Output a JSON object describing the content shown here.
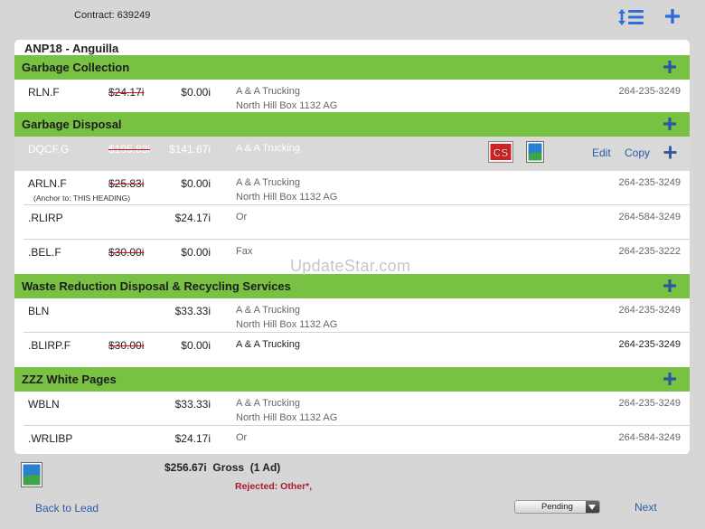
{
  "header": {
    "contract": "Contract: 639249",
    "sort_icon": "sort-list-icon",
    "add_icon": "plus-icon"
  },
  "panel": {
    "title": "ANP18 - Anguilla"
  },
  "sections": [
    {
      "heading": "Garbage Collection",
      "rows": [
        {
          "code": "RLN.F",
          "old_price": "$24.17i",
          "price": "$0.00i",
          "name": "A & A Trucking",
          "address": "North Hill Box 1132 AG",
          "phone": "264-235-3249"
        }
      ]
    },
    {
      "heading": "Garbage Disposal",
      "rows": [
        {
          "code": "DQCF.G",
          "old_price": "$195.83i",
          "price": "$141.67i",
          "name": "A & A Trucking",
          "cs_label": "CS",
          "edit": "Edit",
          "copy": "Copy"
        },
        {
          "code": "ARLN.F",
          "old_price": "$25.83i",
          "price": "$0.00i",
          "name": "A & A Trucking",
          "address": "North Hill Box 1132 AG",
          "anchor": "(Anchor to: THIS HEADING)",
          "phone": "264-235-3249"
        },
        {
          "code": ".RLIRP",
          "price": "$24.17i",
          "name": "Or",
          "phone": "264-584-3249"
        },
        {
          "code": ".BEL.F",
          "old_price": "$30.00i",
          "price": "$0.00i",
          "name": "Fax",
          "phone": "264-235-3222"
        }
      ]
    },
    {
      "heading": "Waste Reduction Disposal & Recycling Services",
      "rows": [
        {
          "code": "BLN",
          "price": "$33.33i",
          "name": "A & A Trucking",
          "address": "North Hill Box 1132 AG",
          "phone": "264-235-3249"
        },
        {
          "code": ".BLIRP.F",
          "old_price": "$30.00i",
          "price": "$0.00i",
          "name": "A & A Trucking",
          "phone": "264-235-3249"
        }
      ]
    },
    {
      "heading": "ZZZ White Pages",
      "rows": [
        {
          "code": "WBLN",
          "price": "$33.33i",
          "name": "A & A Trucking",
          "address": "North Hill Box 1132 AG",
          "phone": "264-235-3249"
        },
        {
          "code": ".WRLIBP",
          "price": "$24.17i",
          "name": "Or",
          "phone": "264-584-3249"
        }
      ]
    }
  ],
  "watermark": "UpdateStar.com",
  "footer": {
    "total": "$256.67i  Gross  (1 Ad)",
    "rejected": "Rejected: Other*,",
    "back": "Back to Lead",
    "status": "Pending",
    "next": "Next"
  },
  "colors": {
    "heading_green": "#79c143",
    "link_blue": "#2a5ba8",
    "icon_blue": "#2f6fdb",
    "rejected_red": "#b0182a"
  }
}
